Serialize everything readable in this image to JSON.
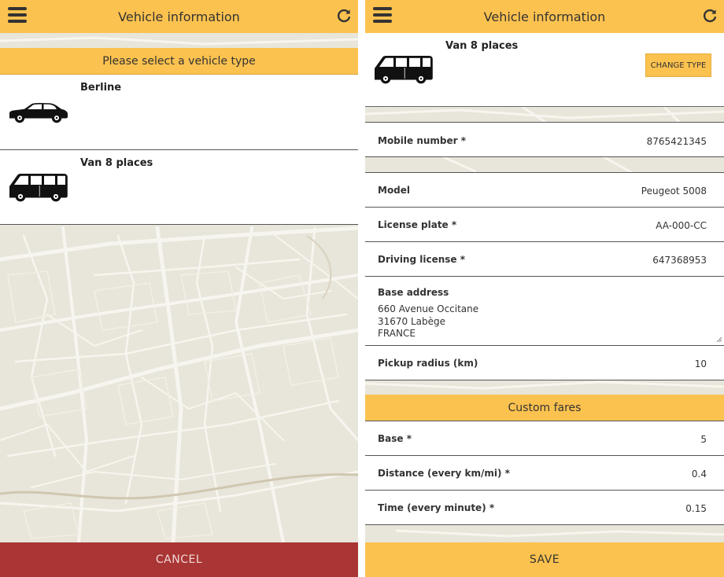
{
  "left_screen": {
    "header": {
      "title": "Vehicle information"
    },
    "prompt": "Please select a vehicle type",
    "vehicle_types": [
      {
        "label": "Berline",
        "icon": "sedan-car-icon"
      },
      {
        "label": "Van 8 places",
        "icon": "van-icon"
      }
    ],
    "cancel_label": "CANCEL"
  },
  "right_screen": {
    "header": {
      "title": "Vehicle information"
    },
    "selected_vehicle": {
      "label": "Van 8 places",
      "icon": "van-icon"
    },
    "change_type_label": "CHANGE TYPE",
    "fields": {
      "mobile_number": {
        "label": "Mobile number *",
        "value": "8765421345"
      },
      "model": {
        "label": "Model",
        "value": "Peugeot 5008"
      },
      "license_plate": {
        "label": "License plate *",
        "value": "AA-000-CC"
      },
      "driving_license": {
        "label": "Driving license *",
        "value": "647368953"
      },
      "base_address": {
        "label": "Base address",
        "lines": [
          "660 Avenue Occitane",
          "31670 Labège",
          "FRANCE"
        ]
      },
      "pickup_radius": {
        "label": "Pickup radius (km)",
        "value": "10"
      }
    },
    "custom_fares_title": "Custom fares",
    "fares": {
      "base": {
        "label": "Base *",
        "value": "5"
      },
      "distance": {
        "label": "Distance (every km/mi) *",
        "value": "0.4"
      },
      "time": {
        "label": "Time (every minute) *",
        "value": "0.15"
      }
    },
    "save_label": "SAVE"
  },
  "colors": {
    "accent_yellow": "#fcc24f",
    "cancel_red": "#a93634",
    "map_background": "#e8e5da",
    "map_road": "#f6f4ee"
  }
}
